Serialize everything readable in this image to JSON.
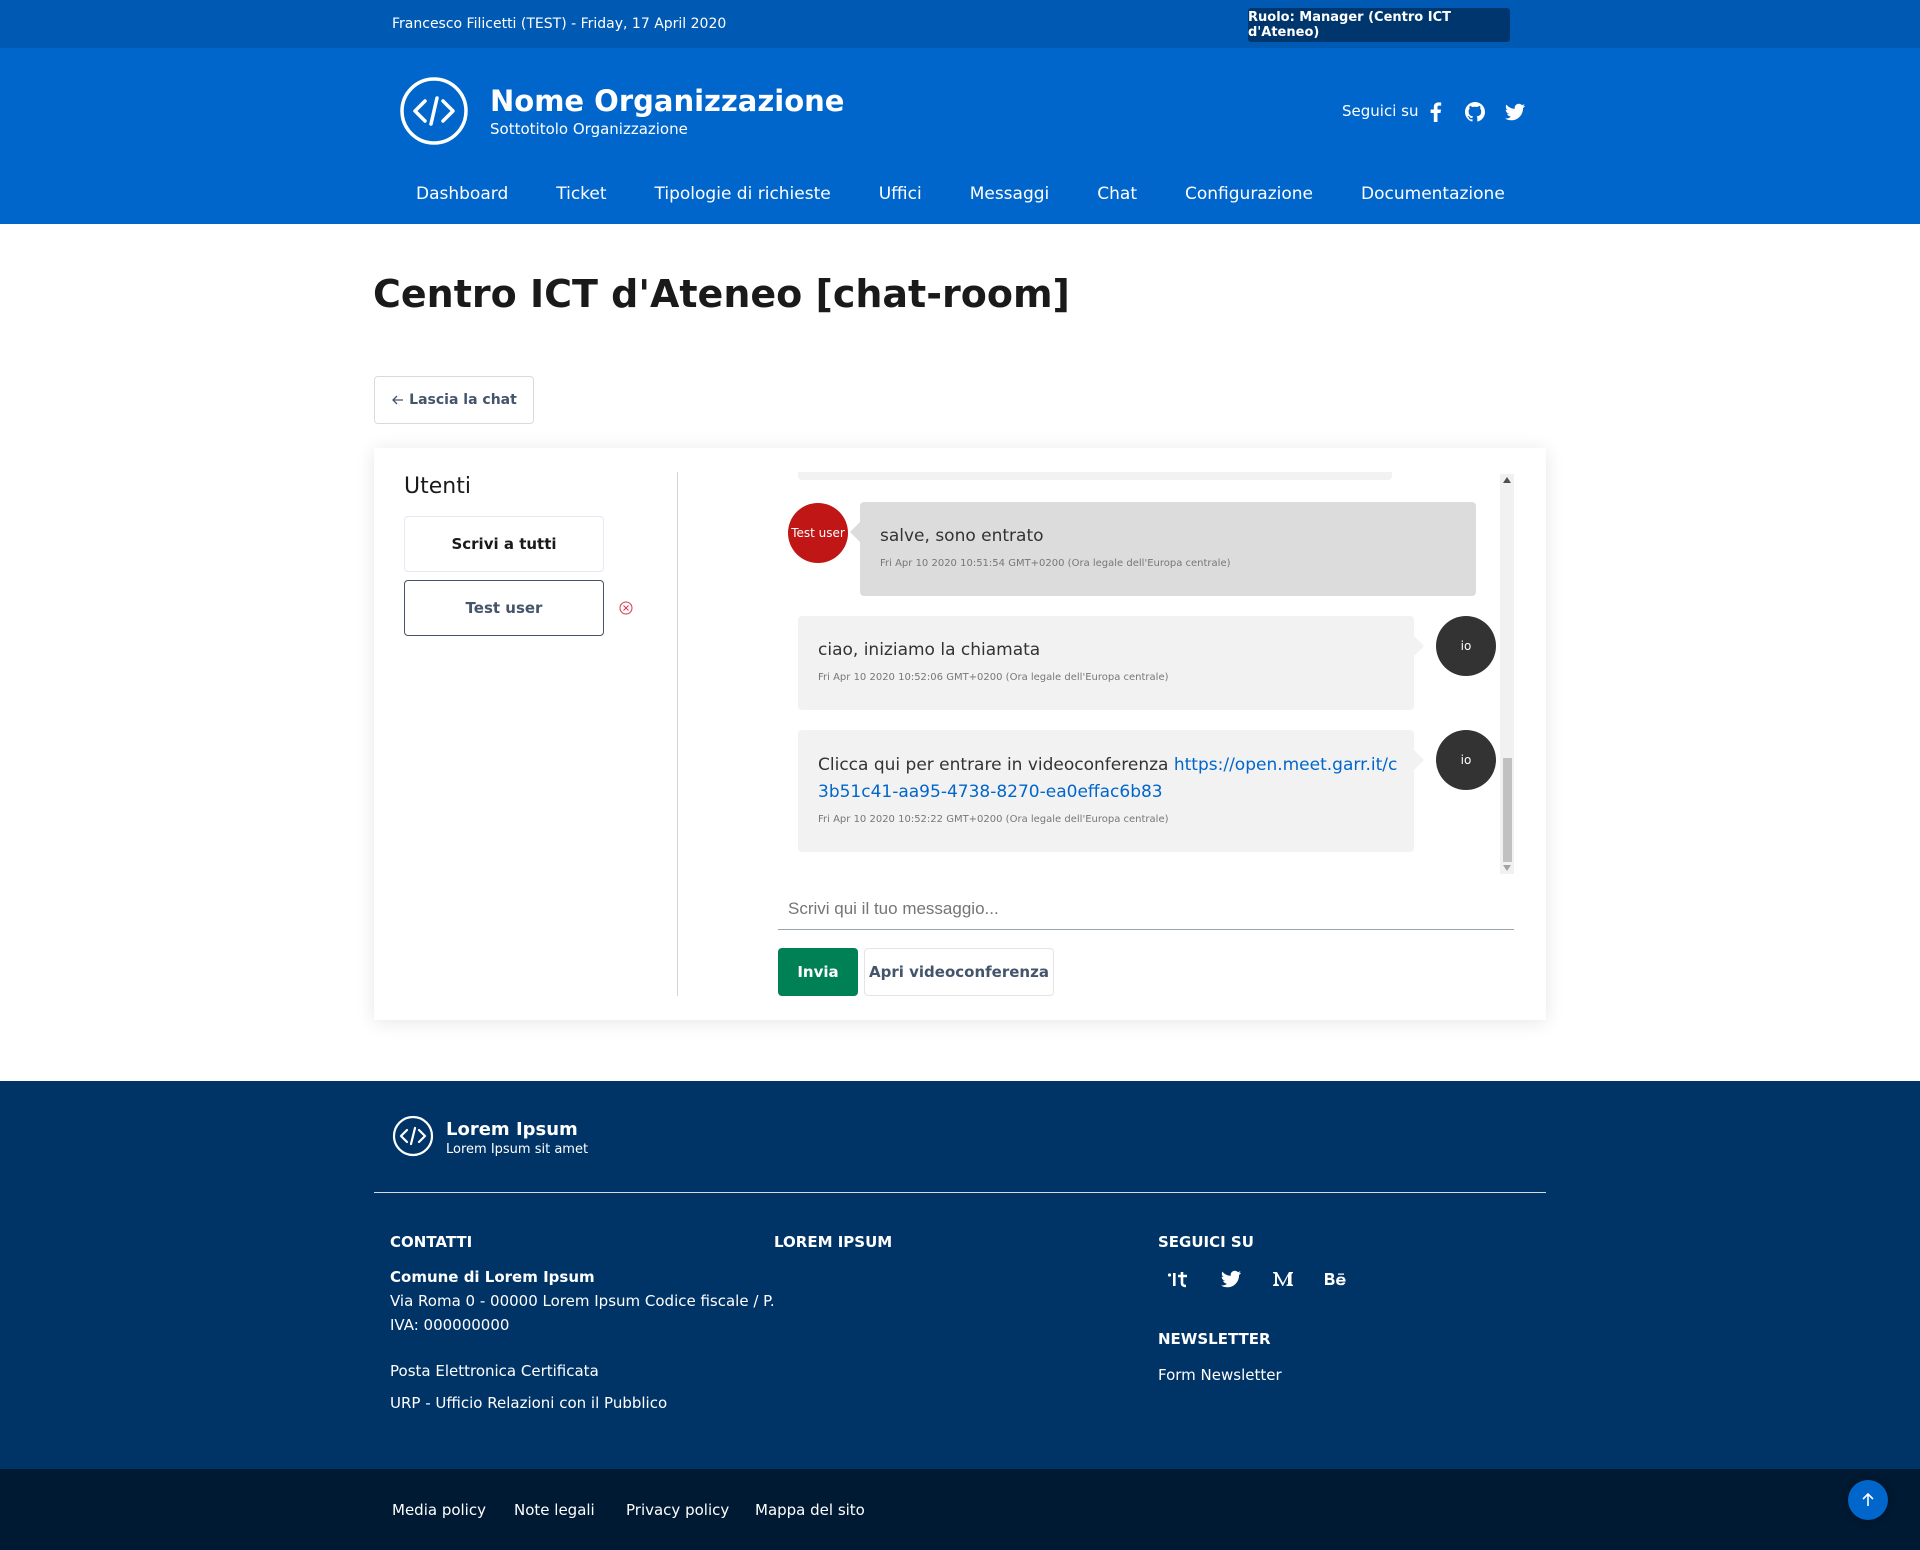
{
  "slim_header": {
    "user_date": "Francesco Filicetti (TEST) - Friday, 17 April 2020",
    "role": "Ruolo: Manager (Centro ICT d'Ateneo)"
  },
  "header": {
    "org_name": "Nome Organizzazione",
    "org_subtitle": "Sottotitolo Organizzazione",
    "follow_label": "Seguici su",
    "social_icons": [
      "facebook-icon",
      "github-icon",
      "twitter-icon"
    ]
  },
  "nav": [
    "Dashboard",
    "Ticket",
    "Tipologie di richieste",
    "Uffici",
    "Messaggi",
    "Chat",
    "Configurazione",
    "Documentazione"
  ],
  "page": {
    "title": "Centro ICT d'Ateneo [chat-room]",
    "leave_label": "Lascia la chat"
  },
  "chat": {
    "users_title": "Utenti",
    "write_all_label": "Scrivi a tutti",
    "users": [
      "Test user"
    ],
    "messages": [
      {
        "author": "Test user",
        "text": "salve, sono entrato",
        "time": "Fri Apr 10 2020 10:51:54 GMT+0200 (Ora legale dell'Europa centrale)"
      },
      {
        "author": "io",
        "text": "ciao, iniziamo la chiamata",
        "time": "Fri Apr 10 2020 10:52:06 GMT+0200 (Ora legale dell'Europa centrale)"
      },
      {
        "author": "io",
        "text": "Clicca qui per entrare in videoconferenza",
        "link": "https://open.meet.garr.it/c3b51c41-aa95-4738-8270-ea0effac6b83",
        "time": "Fri Apr 10 2020 10:52:22 GMT+0200 (Ora legale dell'Europa centrale)"
      }
    ],
    "input_placeholder": "Scrivi qui il tuo messaggio...",
    "send_label": "Invia",
    "video_label": "Apri videoconferenza"
  },
  "footer": {
    "name": "Lorem Ipsum",
    "subtitle": "Lorem Ipsum sit amet",
    "contacts_title": "CONTATTI",
    "contacts_org": "Comune di Lorem Ipsum",
    "contacts_address_1": "Via Roma 0 - 00000 Lorem Ipsum Codice fiscale / P.",
    "contacts_address_2": "IVA: 000000000",
    "pec": "Posta Elettronica Certificata",
    "urp": "URP - Ufficio Relazioni con il Pubblico",
    "col2_title": "LOREM IPSUM",
    "follow_title": "SEGUICI SU",
    "follow_icons": [
      "designers-italia-icon",
      "twitter-icon",
      "medium-icon",
      "behance-icon"
    ],
    "newsletter_title": "NEWSLETTER",
    "newsletter_link": "Form Newsletter"
  },
  "bottom_links": [
    "Media policy",
    "Note legali",
    "Privacy policy",
    "Mappa del sito"
  ],
  "colors": {
    "slim": "#0059b3",
    "header": "#0066cc",
    "footer": "#003366",
    "bottom": "#001a33",
    "send": "#008055",
    "avatar_user": "#c01616",
    "avatar_me": "#333333"
  }
}
